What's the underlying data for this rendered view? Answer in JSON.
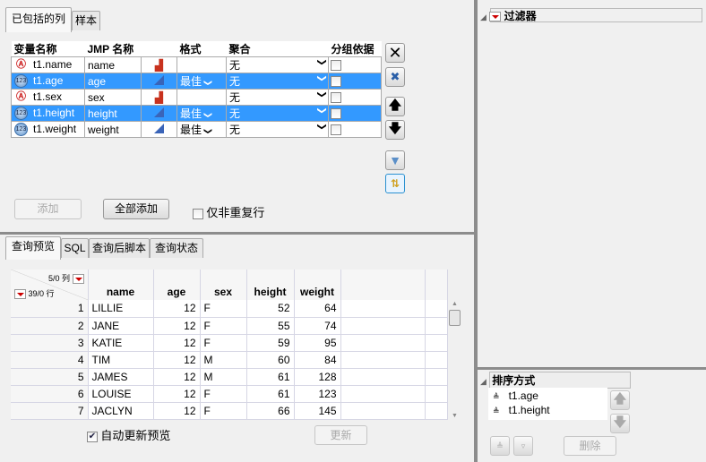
{
  "top_tabs": [
    "已包括的列",
    "样本"
  ],
  "columns_table": {
    "headers": [
      "变量名称",
      "JMP 名称",
      "",
      "格式",
      "聚合",
      "分组依据"
    ],
    "rows": [
      {
        "var": "t1.name",
        "jmp": "name",
        "type": "character",
        "format": "",
        "agg": "无",
        "selected": false
      },
      {
        "var": "t1.age",
        "jmp": "age",
        "type": "numeric",
        "format": "最佳",
        "agg": "无",
        "selected": true
      },
      {
        "var": "t1.sex",
        "jmp": "sex",
        "type": "character",
        "format": "",
        "agg": "无",
        "selected": false
      },
      {
        "var": "t1.height",
        "jmp": "height",
        "type": "numeric",
        "format": "最佳",
        "agg": "无",
        "selected": true
      },
      {
        "var": "t1.weight",
        "jmp": "weight",
        "type": "numeric",
        "format": "最佳",
        "agg": "无",
        "selected": false
      }
    ]
  },
  "buttons": {
    "add": "添加",
    "add_all": "全部添加",
    "distinct_only": "仅非重复行",
    "update": "更新",
    "delete": "删除"
  },
  "bottom_tabs": [
    "查询预览",
    "SQL",
    "查询后脚本",
    "查询状态"
  ],
  "preview": {
    "cols_count": "5/0 列",
    "rows_count": "39/0 行",
    "headers": [
      "name",
      "age",
      "sex",
      "height",
      "weight"
    ],
    "rows": [
      [
        "1",
        "LILLIE",
        "12",
        "F",
        "52",
        "64"
      ],
      [
        "2",
        "JANE",
        "12",
        "F",
        "55",
        "74"
      ],
      [
        "3",
        "KATIE",
        "12",
        "F",
        "59",
        "95"
      ],
      [
        "4",
        "TIM",
        "12",
        "M",
        "60",
        "84"
      ],
      [
        "5",
        "JAMES",
        "12",
        "M",
        "61",
        "128"
      ],
      [
        "6",
        "LOUISE",
        "12",
        "F",
        "61",
        "123"
      ],
      [
        "7",
        "JACLYN",
        "12",
        "F",
        "66",
        "145"
      ]
    ],
    "auto_update": "自动更新预览",
    "auto_update_checked": true
  },
  "filter": {
    "title": "过滤器"
  },
  "sort": {
    "title": "排序方式",
    "items": [
      "t1.age",
      "t1.height"
    ]
  }
}
